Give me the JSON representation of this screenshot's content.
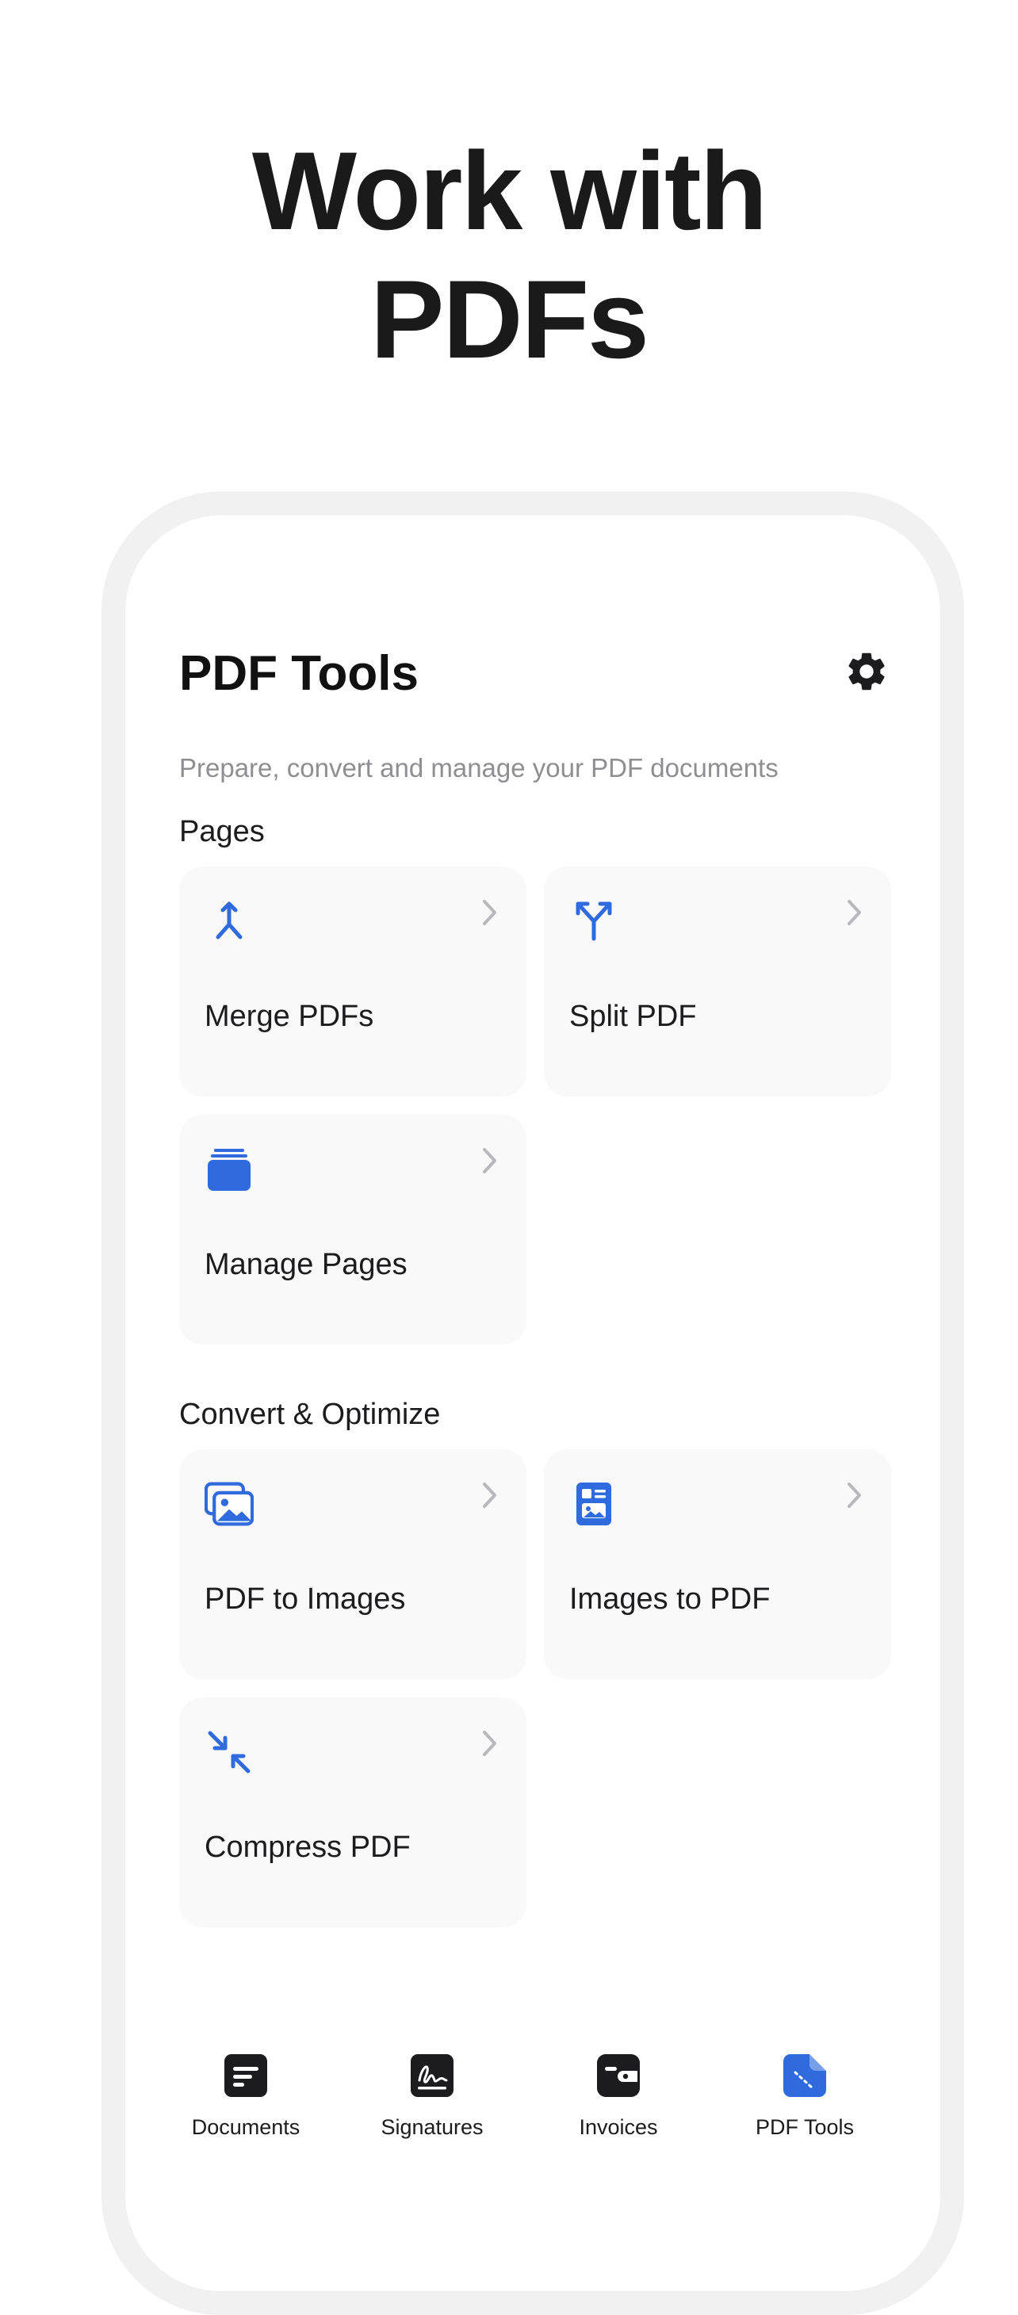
{
  "headline": {
    "line1": "Work with",
    "line2": "PDFs"
  },
  "app": {
    "title": "PDF Tools",
    "subtitle": "Prepare, convert and manage your PDF documents"
  },
  "icons": {
    "settings": "gear-icon",
    "merge": "merge-arrows-icon",
    "split": "split-arrows-icon",
    "manage": "stacked-pages-icon",
    "pdf_to_images": "photos-icon",
    "images_to_pdf": "image-document-icon",
    "compress": "compress-arrows-icon",
    "chevron": "chevron-right-icon"
  },
  "sections": {
    "pages": {
      "title": "Pages",
      "cards": [
        {
          "label": "Merge PDFs"
        },
        {
          "label": "Split PDF"
        },
        {
          "label": "Manage Pages"
        }
      ]
    },
    "convert": {
      "title": "Convert & Optimize",
      "cards": [
        {
          "label": "PDF to Images"
        },
        {
          "label": "Images to PDF"
        },
        {
          "label": "Compress PDF"
        }
      ]
    }
  },
  "tabbar": {
    "active": "PDF Tools",
    "tabs": [
      {
        "label": "Documents",
        "icon": "document-icon"
      },
      {
        "label": "Signatures",
        "icon": "signature-icon"
      },
      {
        "label": "Invoices",
        "icon": "wallet-icon"
      },
      {
        "label": "PDF Tools",
        "icon": "pdf-tools-icon"
      }
    ]
  },
  "colors": {
    "accent": "#2f6bde",
    "text": "#1c1c1e",
    "muted": "#8e8e93",
    "card": "#f9f9f9",
    "chevron": "#b8b8bd",
    "frame": "#f1f1f1"
  }
}
